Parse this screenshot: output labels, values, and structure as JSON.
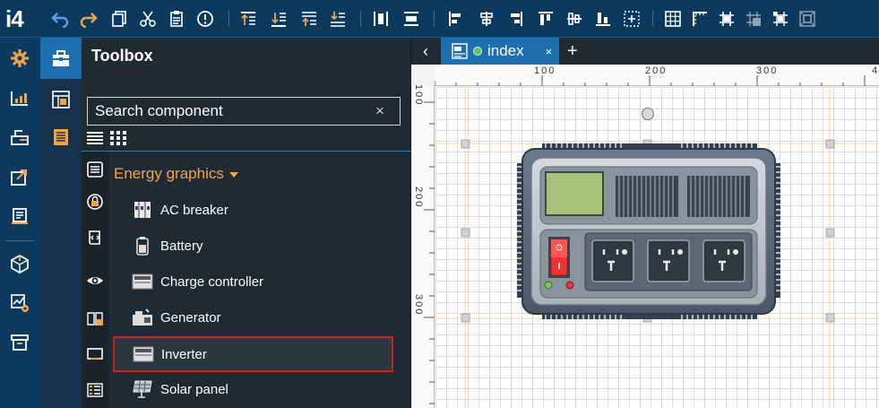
{
  "app": {
    "logo": "i4"
  },
  "toolbox": {
    "title": "Toolbox",
    "search_placeholder": "Search component",
    "search_clear": "×",
    "group": "Energy graphics",
    "items": [
      {
        "label": "AC breaker",
        "icon": "breaker-icon"
      },
      {
        "label": "Battery",
        "icon": "battery-icon"
      },
      {
        "label": "Charge controller",
        "icon": "charge-controller-icon"
      },
      {
        "label": "Generator",
        "icon": "generator-icon"
      },
      {
        "label": "Inverter",
        "icon": "inverter-icon",
        "selected": true
      },
      {
        "label": "Solar panel",
        "icon": "solar-panel-icon"
      }
    ]
  },
  "tabs": {
    "back": "‹",
    "active": {
      "label": "index",
      "close": "×"
    },
    "add": "+"
  },
  "ruler": {
    "top": [
      "100",
      "200",
      "300",
      "4"
    ],
    "left": [
      "100",
      "200",
      "300"
    ]
  },
  "colors": {
    "topbar": "#0c3a5e",
    "accent": "#1d6fb0",
    "group_title": "#f0a54a",
    "selection": "#c82121",
    "guide": "#f5d58b"
  }
}
